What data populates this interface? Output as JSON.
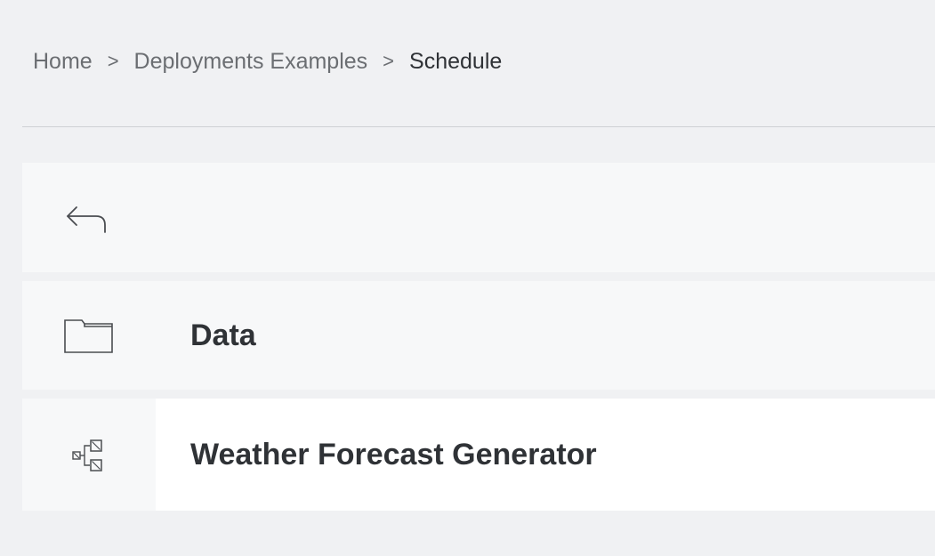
{
  "breadcrumb": {
    "items": [
      "Home",
      "Deployments Examples"
    ],
    "separator": ">",
    "current": "Schedule"
  },
  "rows": {
    "back": {
      "icon": "back-arrow-icon"
    },
    "data": {
      "icon": "folder-icon",
      "label": "Data"
    },
    "flow": {
      "icon": "flow-icon",
      "label": "Weather Forecast Generator"
    }
  },
  "colors": {
    "background": "#f0f1f3",
    "row_background": "#f7f8f9",
    "selected_row": "#ffffff",
    "text": "#2f3236",
    "muted_text": "#6b6e72"
  }
}
